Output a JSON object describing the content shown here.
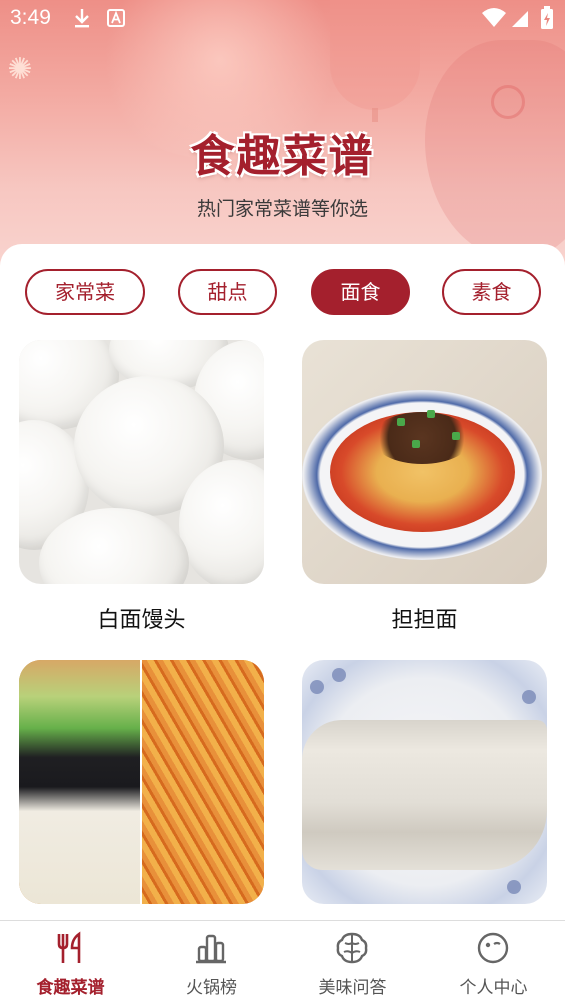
{
  "status_bar": {
    "time": "3:49",
    "icons": [
      "download-icon",
      "a-letter-icon",
      "wifi-icon",
      "signal-icon",
      "battery-icon"
    ]
  },
  "header": {
    "title": "食趣菜谱",
    "subtitle": "热门家常菜谱等你选"
  },
  "category_tabs": [
    {
      "label": "家常菜",
      "active": false
    },
    {
      "label": "甜点",
      "active": false
    },
    {
      "label": "面食",
      "active": true
    },
    {
      "label": "素食",
      "active": false
    }
  ],
  "recipes": [
    {
      "name": "白面馒头",
      "image": "steamed-buns-photo"
    },
    {
      "name": "担担面",
      "image": "dandan-noodles-photo"
    },
    {
      "name": "",
      "image": "cold-noodles-photo"
    },
    {
      "name": "",
      "image": "rolled-crepe-photo"
    }
  ],
  "bottom_nav": [
    {
      "label": "食趣菜谱",
      "icon": "fork-knife-icon",
      "active": true
    },
    {
      "label": "火锅榜",
      "icon": "bar-chart-icon",
      "active": false
    },
    {
      "label": "美味问答",
      "icon": "brain-icon",
      "active": false
    },
    {
      "label": "个人中心",
      "icon": "smiley-icon",
      "active": false
    }
  ],
  "colors": {
    "accent": "#a4202d",
    "inactive_nav": "#555555"
  }
}
